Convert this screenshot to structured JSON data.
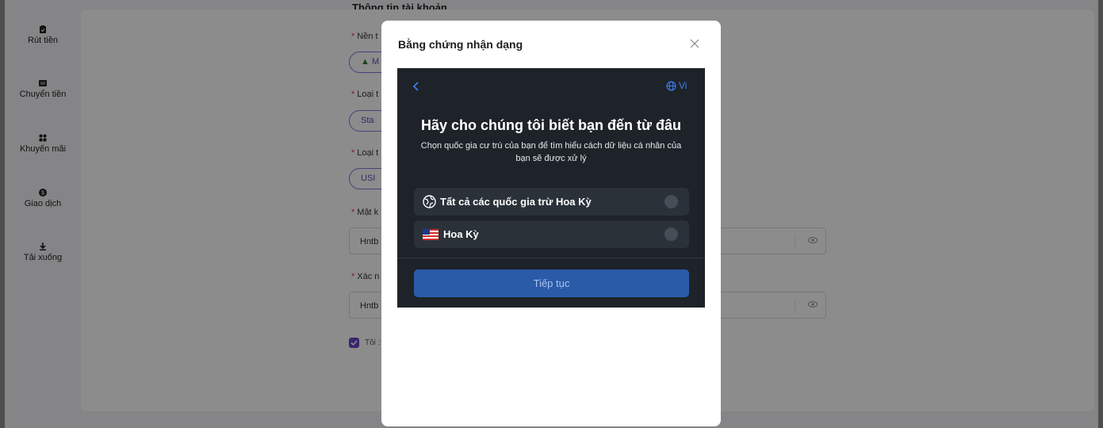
{
  "sidebar": {
    "items": [
      {
        "label": "Rút tiền",
        "icon": "clipboard-icon"
      },
      {
        "label": "Chuyển tiền",
        "icon": "transfer-icon"
      },
      {
        "label": "Khuyến mãi",
        "icon": "grid-icon"
      },
      {
        "label": "Giao dịch",
        "icon": "dollar-coin-icon"
      },
      {
        "label": "Tải xuống",
        "icon": "download-icon"
      }
    ]
  },
  "form": {
    "section_title": "Thông tin tài khoản",
    "required_mark": "*",
    "platform_label": "Nền t",
    "platform_value": "M",
    "type1_label": "Loại t",
    "type1_value": "Sta",
    "type2_label": "Loại t",
    "type2_value": "USI",
    "password_label": "Mật k",
    "password_value": "Hntb",
    "confirm_label": "Xác n",
    "confirm_value": "Hntb",
    "agree_text": "Tôi :"
  },
  "modal": {
    "title": "Bằng chứng nhận dạng",
    "lang": "Vi",
    "heading": "Hãy cho chúng tôi biết bạn đến từ đâu",
    "subheading": "Chọn quốc gia cư trú của bạn để tìm hiểu cách dữ liệu cá nhân của bạn sẽ được xử lý",
    "options": [
      {
        "label": "Tất cả các quốc gia trừ Hoa Kỳ",
        "icon": "globe-icon",
        "selected": false
      },
      {
        "label": "Hoa Kỳ",
        "icon": "us-flag-icon",
        "selected": false
      }
    ],
    "continue_label": "Tiếp tục"
  },
  "colors": {
    "accent": "#6b46c1",
    "frame_bg": "#1e2329",
    "option_bg": "#2b3139",
    "button": "#2a5ba8",
    "link_blue": "#3b82f6"
  }
}
